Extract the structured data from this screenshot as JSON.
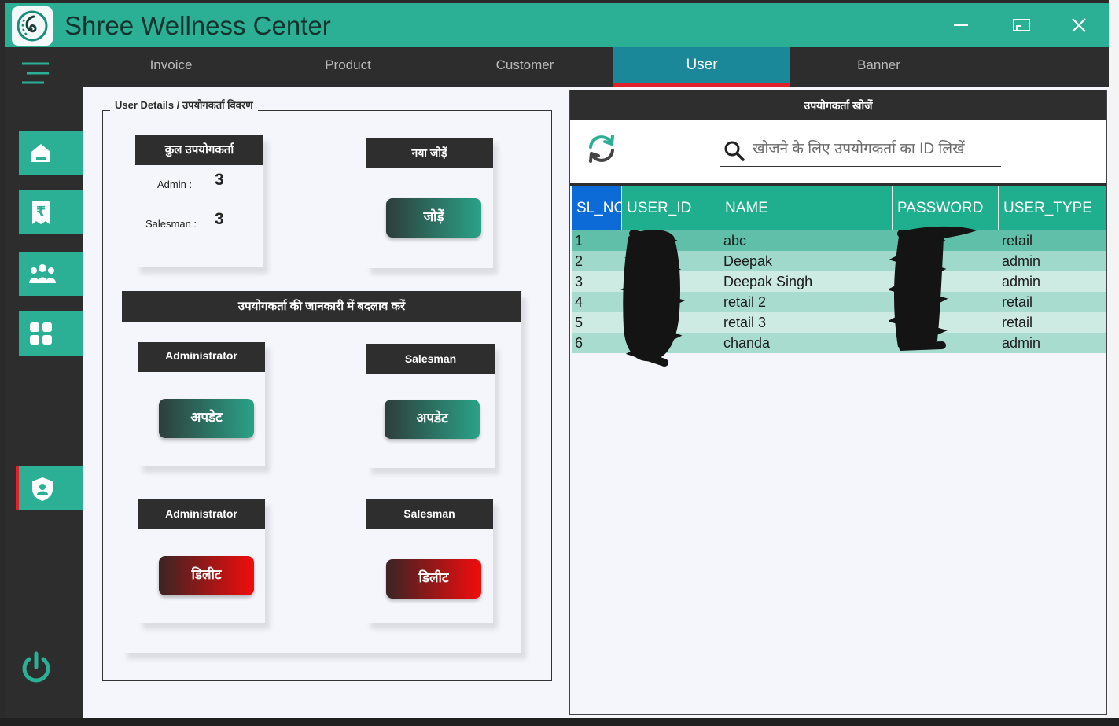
{
  "window": {
    "title": "Shree Wellness Center",
    "accent": "#2bb096",
    "dark": "#2d2d2d",
    "danger": "#e0202a"
  },
  "tabs": [
    "Invoice",
    "Product",
    "Customer",
    "User",
    "Banner"
  ],
  "active_tab": "User",
  "sidebar": {
    "items": [
      "home-icon",
      "rupee-receipt-icon",
      "users-group-icon",
      "grid-apps-icon",
      "user-shield-icon"
    ],
    "active": "user-shield-icon",
    "footer": "power-icon"
  },
  "user_details": {
    "legend": "User Details / उपयोगकर्ता विवरण",
    "total_header": "कुल उपयोगकर्ता",
    "admin_label": "Admin :",
    "admin_count": "3",
    "salesman_label": "Salesman :",
    "salesman_count": "3",
    "add_header": "नया जोड़ें",
    "add_button": "जोड़ें",
    "modify_header": "उपयोगकर्ता की जानकारी में बदलाव करें",
    "update_admin_header": "Administrator",
    "update_admin_button": "अपडेट",
    "update_salesman_header": "Salesman",
    "update_salesman_button": "अपडेट",
    "delete_admin_header": "Administrator",
    "delete_admin_button": "डिलीट",
    "delete_salesman_header": "Salesman",
    "delete_salesman_button": "डिलीट"
  },
  "search": {
    "header": "उपयोगकर्ता खोजें",
    "placeholder": "खोजने के लिए उपयोगकर्ता का ID लिखें"
  },
  "table": {
    "columns": [
      "SL_NO",
      "USER_ID",
      "NAME",
      "PASSWORD",
      "USER_TYPE"
    ],
    "column_header_display": [
      "SL_NC",
      "USER_ID",
      "NAME",
      "PASSWORD",
      "USER_TYPE"
    ],
    "rows": [
      {
        "sl": "1",
        "name": "abc",
        "type": "retail"
      },
      {
        "sl": "2",
        "name": "Deepak",
        "type": "admin"
      },
      {
        "sl": "3",
        "name": "Deepak Singh",
        "type": "admin"
      },
      {
        "sl": "4",
        "name": "retail 2",
        "type": "retail"
      },
      {
        "sl": "5",
        "name": "retail 3",
        "type": "retail"
      },
      {
        "sl": "6",
        "name": "chanda",
        "type": "admin"
      }
    ],
    "row_colors": [
      "#5fbfa8",
      "#9fd9cb",
      "#cdeae3",
      "#a8dccf",
      "#cdeae3",
      "#a8dccf"
    ]
  }
}
